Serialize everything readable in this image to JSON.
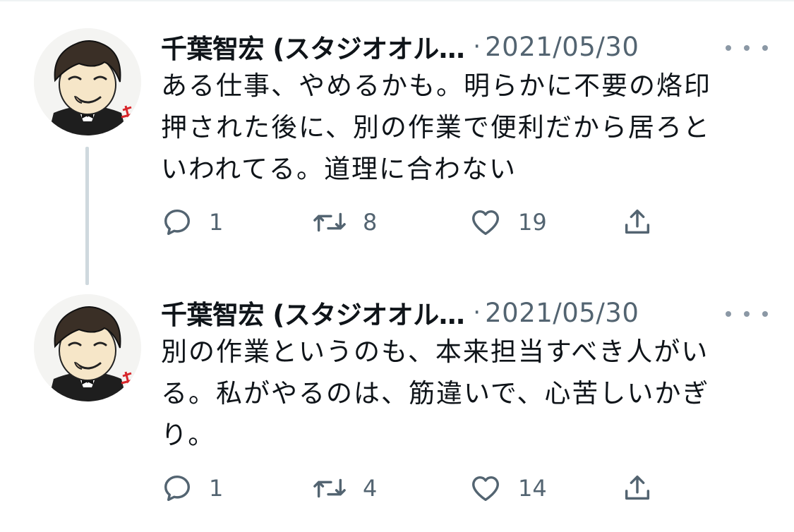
{
  "tweets": [
    {
      "display_name": "千葉智宏 (スタジオオル…",
      "separator": "·",
      "date": "2021/05/30",
      "avatar_icon": "cartoon-avatar-icon",
      "text_lines": [
        "ある仕事、やめるかも。明らかに不要の烙印",
        "押された後に、別の作業で便利だから居ろと",
        "いわれてる。道理に合わない"
      ],
      "replies": "1",
      "retweets": "8",
      "likes": "19"
    },
    {
      "display_name": "千葉智宏 (スタジオオル…",
      "separator": "·",
      "date": "2021/05/30",
      "avatar_icon": "cartoon-avatar-icon",
      "text_lines": [
        "別の作業というのも、本来担当すべき人がい",
        "る。私がやるのは、筋違いで、心苦しいかぎ",
        "り。"
      ],
      "replies": "1",
      "retweets": "4",
      "likes": "14"
    }
  ],
  "colors": {
    "text": "#0f1419",
    "muted": "#536471",
    "thread_line": "#cfd9de"
  },
  "icons": [
    "reply-icon",
    "retweet-icon",
    "like-icon",
    "share-icon",
    "more-icon"
  ]
}
